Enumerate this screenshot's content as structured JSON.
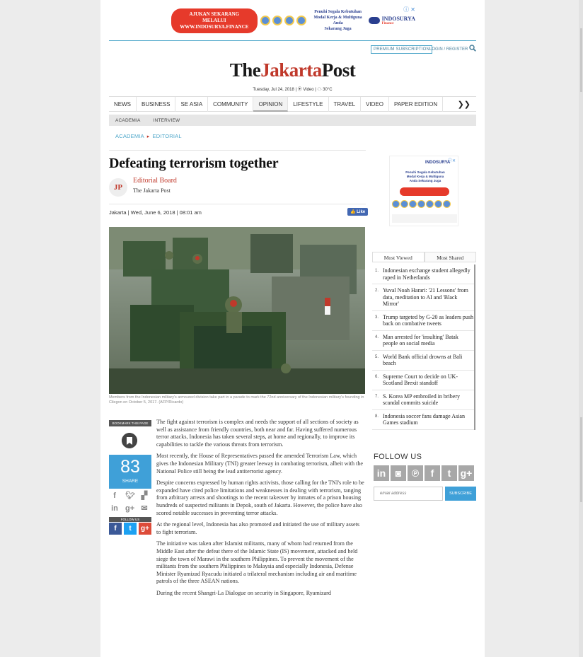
{
  "ad": {
    "pill_line1": "AJUKAN SEKARANG MELALUI",
    "pill_line2": "WWW.INDOSURYA.FINANCE",
    "tagline1": "Penuhi Segala Kebutuhan",
    "tagline2": "Modal Kerja & Multiguna Anda",
    "tagline3": "Sekarang Juga",
    "brand": "INDOSURYA",
    "brand_sub": "Finance",
    "close": "ⓘ ✕"
  },
  "header": {
    "premium": "PREMIUM SUBSCRIPTION",
    "login": "LOGIN / REGISTER",
    "masthead_the": "The",
    "masthead_jakarta": "Jakarta",
    "masthead_post": "Post",
    "dateline": "Tuesday, Jul 24, 2018 | ⦿ Video | ☁ 30°C"
  },
  "nav": {
    "items": [
      "NEWS",
      "BUSINESS",
      "SE ASIA",
      "COMMUNITY",
      "OPINION",
      "LIFESTYLE",
      "TRAVEL",
      "VIDEO",
      "PAPER EDITION"
    ],
    "more": "❯❯"
  },
  "subnav": {
    "items": [
      "ACADEMIA",
      "INTERVIEW"
    ]
  },
  "breadcrumb": {
    "first": "ACADEMIA",
    "sep": "▸",
    "second": "EDITORIAL"
  },
  "article": {
    "headline": "Defeating terrorism together",
    "author_initials": "JP",
    "author": "Editorial Board",
    "org": "The Jakarta Post",
    "date": "Jakarta | Wed, June 6, 2018 | 08:01 am",
    "like": "👍 Like",
    "caption": "Members from the Indonesian military's armoured division take part in a parade to mark the 72nd anniversary of the Indonesian military's founding in Cilegon on October 5, 2017. (AFP/Ricardo)",
    "paragraphs": [
      "The fight against terrorism is complex and needs the support of all sections of society as well as assistance from friendly countries, both near and far. Having suffered numerous terror attacks, Indonesia has taken several steps, at home and regionally, to improve its capabilities to tackle the various threats from terrorism.",
      "Most recently, the House of Representatives passed the amended Terrorism Law, which gives the Indonesian Military (TNI) greater leeway in combating terrorism, albeit with the National Police still being the lead antiterrorist agency.",
      "Despite concerns expressed by human rights activists, those calling for the TNI's role to be expanded have cited police limitations and weaknesses in dealing with terrorism, ranging from arbitrary arrests and shootings to the recent takeover by inmates of a prison housing hundreds of suspected militants in Depok, south of Jakarta. However, the police have also scored notable successes in preventing terror attacks.",
      "At the regional level, Indonesia has also promoted and initiated the use of military assets to fight terrorism.",
      "The initiative was taken after Islamist militants, many of whom had returned from the Middle East after the defeat there of the Islamic State (IS) movement, attacked and held siege the town of Marawi in the southern Philippines. To prevent the movement of the militants from the southern Philippines to Malaysia and especially Indonesia, Defense Minister Ryamizad Ryacudu initiated a trilateral mechanism including air and maritime patrols of the three ASEAN nations.",
      "During the recent Shangri-La Dialogue on security in Singapore, Ryamizard"
    ]
  },
  "share": {
    "bookmark": "BOOKMARK THIS PAGE",
    "count": "83",
    "label": "SHARE",
    "follow": "FOLLOW US"
  },
  "sidebar": {
    "ad_logo": "INDOSURYA",
    "ad_text": "Penuhi Segala Kebutuhan Modal Kerja & Multiguna Anda Sekarang Juga",
    "tabs": [
      "Most Viewed",
      "Most Shared"
    ],
    "most_viewed": [
      {
        "n": "1.",
        "t": "Indonesian exchange student allegedly raped in Netherlands"
      },
      {
        "n": "2.",
        "t": "Yuval Noah Harari: '21 Lessons' from data, meditation to AI and 'Black Mirror'"
      },
      {
        "n": "3.",
        "t": "Trump targeted by G-20 as leaders push back on combative tweets"
      },
      {
        "n": "4.",
        "t": "Man arrested for 'insulting' Batak people on social media"
      },
      {
        "n": "5.",
        "t": "World Bank official drowns at Bali beach"
      },
      {
        "n": "6.",
        "t": "Supreme Court to decide on UK-Scotland Brexit standoff"
      },
      {
        "n": "7.",
        "t": "S. Korea MP embroiled in bribery scandal commits suicide"
      },
      {
        "n": "8.",
        "t": "Indonesia soccer fans damage Asian Games stadium"
      }
    ],
    "follow_title": "FOLLOW US",
    "email_placeholder": "email address",
    "subscribe": "SUBSCRIBE"
  },
  "colors": {
    "brand_red": "#c0392b",
    "accent_blue": "#3fa0d8"
  }
}
